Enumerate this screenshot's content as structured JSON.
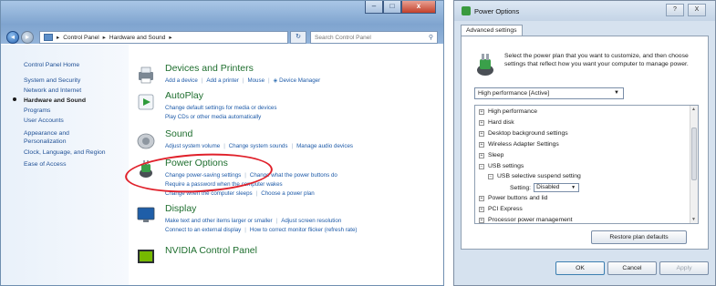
{
  "control_panel": {
    "address": {
      "segments": [
        "Control Panel",
        "Hardware and Sound"
      ],
      "separator": "▸"
    },
    "search": {
      "placeholder": "Search Control Panel"
    },
    "caption": {
      "minimize": "–",
      "maximize": "□",
      "close": "x"
    },
    "left_pane": {
      "items": [
        {
          "label": "Control Panel Home"
        },
        {
          "label": "System and Security"
        },
        {
          "label": "Network and Internet"
        },
        {
          "label": "Hardware and Sound"
        },
        {
          "label": "Programs"
        },
        {
          "label": "User Accounts"
        },
        {
          "label": "Appearance and"
        },
        {
          "label": "Personalization"
        },
        {
          "label": "Clock, Language, and Region"
        },
        {
          "label": "Ease of Access"
        }
      ]
    },
    "categories": [
      {
        "title": "Devices and Printers",
        "links": [
          "Add a device",
          "Add a printer",
          "Mouse",
          "Device Manager"
        ]
      },
      {
        "title": "AutoPlay",
        "links": [
          "Change default settings for media or devices",
          "Play CDs or other media automatically"
        ]
      },
      {
        "title": "Sound",
        "links": [
          "Adjust system volume",
          "Change system sounds",
          "Manage audio devices"
        ]
      },
      {
        "title": "Power Options",
        "links": [
          "Change power-saving settings",
          "Change what the power buttons do",
          "Require a password when the computer wakes",
          "Change when the computer sleeps",
          "Choose a power plan"
        ]
      },
      {
        "title": "Display",
        "links": [
          "Make text and other items larger or smaller",
          "Adjust screen resolution",
          "Connect to an external display",
          "How to correct monitor flicker (refresh rate)"
        ]
      },
      {
        "title": "NVIDIA Control Panel",
        "links": []
      }
    ],
    "highlight_color": "#e0202a",
    "link_color": "#1d5aa8",
    "title_color": "#1e6e2e"
  },
  "power_options": {
    "title": "Power Options",
    "help": "?",
    "close": "X",
    "tab": "Advanced settings",
    "intro": "Select the power plan that you want to customize, and then choose settings that reflect how you want your computer to manage power.",
    "plan": "High performance [Active]",
    "tree": [
      {
        "label": "High performance",
        "expander": "+"
      },
      {
        "label": "Hard disk",
        "expander": "+"
      },
      {
        "label": "Desktop background settings",
        "expander": "+"
      },
      {
        "label": "Wireless Adapter Settings",
        "expander": "+"
      },
      {
        "label": "Sleep",
        "expander": "+"
      },
      {
        "label": "USB settings",
        "expander": "−"
      },
      {
        "label": "USB selective suspend setting",
        "expander": "−"
      },
      {
        "label": "Setting:",
        "value": "Disabled"
      },
      {
        "label": "Power buttons and lid",
        "expander": "+"
      },
      {
        "label": "PCI Express",
        "expander": "+"
      },
      {
        "label": "Processor power management",
        "expander": "+"
      }
    ],
    "buttons": {
      "restore": "Restore plan defaults",
      "ok": "OK",
      "cancel": "Cancel",
      "apply": "Apply"
    }
  }
}
